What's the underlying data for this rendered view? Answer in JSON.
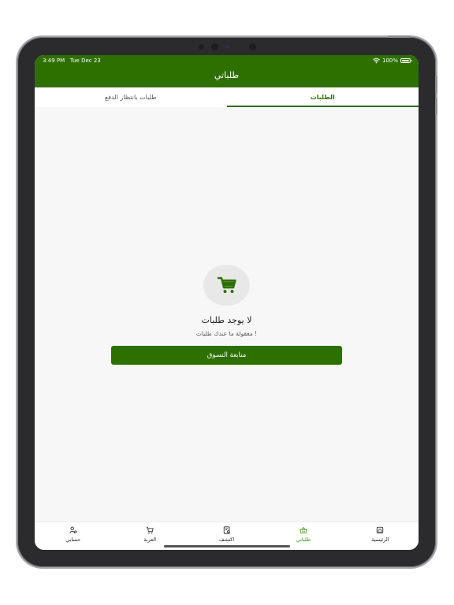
{
  "status_bar": {
    "time": "3:49 PM",
    "date": "Tue Dec 23",
    "battery": "100%"
  },
  "header": {
    "title": "طلباتي"
  },
  "tabs": [
    {
      "label": "طلبات بانتظار الدفع",
      "active": false
    },
    {
      "label": "الطلبات",
      "active": true
    }
  ],
  "empty_state": {
    "icon": "cart-icon",
    "title": "لا يوجد طلبات",
    "subtitle": "معقولة ما عندك طلبات !",
    "button_label": "متابعة التسوق"
  },
  "bottom_nav": [
    {
      "label": "حسابي",
      "icon": "user-icon",
      "active": false
    },
    {
      "label": "العربة",
      "icon": "cart-icon",
      "active": false
    },
    {
      "label": "اكتشف",
      "icon": "discover-icon",
      "active": false
    },
    {
      "label": "طلباتي",
      "icon": "basket-icon",
      "active": true
    },
    {
      "label": "الرئيسية",
      "icon": "home-icon",
      "active": false
    }
  ],
  "colors": {
    "primary": "#2e7000",
    "nav_active": "#3b9a10",
    "background": "#f7f7f7"
  }
}
